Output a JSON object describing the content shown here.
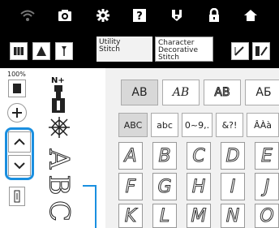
{
  "topbar": {
    "icons": [
      "wifi-icon",
      "camera-icon",
      "gear-icon",
      "help-icon",
      "presser-foot-icon",
      "lock-icon",
      "home-icon"
    ]
  },
  "toolbar": {
    "tab_utility": "Utility\nStitch",
    "tab_character": "Character\nDecorative\nStitch"
  },
  "left": {
    "zoom": "100%"
  },
  "preview": {
    "needle_label": "N+",
    "letters": [
      "A",
      "B",
      "C"
    ]
  },
  "font_tabs": [
    "AB",
    "AB",
    "AB",
    "АБ"
  ],
  "categories": [
    "ABC",
    "abc",
    "0~9,.",
    "&?!",
    "ÂÀà"
  ],
  "keys": [
    [
      "A",
      "B",
      "C",
      "D",
      "E"
    ],
    [
      "F",
      "G",
      "H",
      "I",
      "J"
    ],
    [
      "K",
      "L",
      "M",
      "N",
      "O"
    ]
  ]
}
